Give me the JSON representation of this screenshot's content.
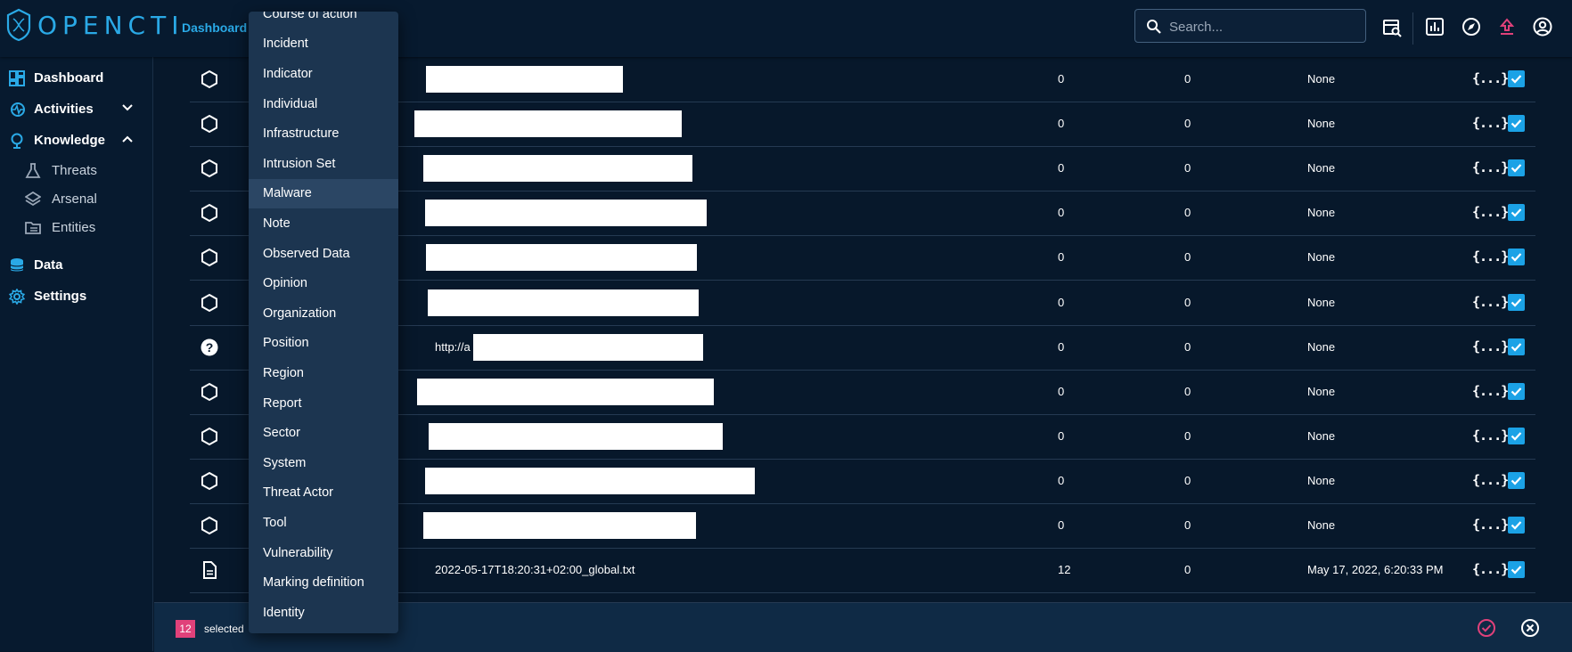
{
  "topbar": {
    "logo_text": "OPENCTI",
    "dashboard_label": "Dashboard",
    "search_placeholder": "Search..."
  },
  "sidebar": {
    "items": [
      {
        "label": "Dashboard",
        "icon": "dashboard-icon"
      },
      {
        "label": "Activities",
        "icon": "activities-icon"
      },
      {
        "label": "Knowledge",
        "icon": "knowledge-icon"
      },
      {
        "label": "Threats",
        "icon": "flask-icon"
      },
      {
        "label": "Arsenal",
        "icon": "layers-icon"
      },
      {
        "label": "Entities",
        "icon": "folder-icon"
      },
      {
        "label": "Data",
        "icon": "database-icon"
      },
      {
        "label": "Settings",
        "icon": "gear-icon"
      }
    ]
  },
  "dropdown": {
    "items": [
      "Course of action",
      "Incident",
      "Indicator",
      "Individual",
      "Infrastructure",
      "Intrusion Set",
      "Malware",
      "Note",
      "Observed Data",
      "Opinion",
      "Organization",
      "Position",
      "Region",
      "Report",
      "Sector",
      "System",
      "Threat Actor",
      "Tool",
      "Vulnerability",
      "Marking definition",
      "Identity"
    ],
    "highlighted": "Malware"
  },
  "table": {
    "rows": [
      {
        "icon": "hexagon-icon",
        "text": "",
        "objects": "0",
        "refs": "0",
        "date": "None"
      },
      {
        "icon": "hexagon-icon",
        "text": "",
        "objects": "0",
        "refs": "0",
        "date": "None"
      },
      {
        "icon": "hexagon-icon",
        "text": "",
        "objects": "0",
        "refs": "0",
        "date": "None"
      },
      {
        "icon": "hexagon-icon",
        "text": "",
        "objects": "0",
        "refs": "0",
        "date": "None"
      },
      {
        "icon": "hexagon-icon",
        "text": "",
        "objects": "0",
        "refs": "0",
        "date": "None"
      },
      {
        "icon": "hexagon-icon",
        "text": "",
        "objects": "0",
        "refs": "0",
        "date": "None"
      },
      {
        "icon": "question-icon",
        "text": "http://a",
        "objects": "0",
        "refs": "0",
        "date": "None"
      },
      {
        "icon": "hexagon-icon",
        "text": "",
        "objects": "0",
        "refs": "0",
        "date": "None"
      },
      {
        "icon": "hexagon-icon",
        "text": "",
        "objects": "0",
        "refs": "0",
        "date": "None"
      },
      {
        "icon": "hexagon-icon",
        "text": "",
        "objects": "0",
        "refs": "0",
        "date": "None"
      },
      {
        "icon": "hexagon-icon",
        "text": "",
        "objects": "0",
        "refs": "0",
        "date": "None"
      },
      {
        "icon": "file-icon",
        "text": "2022-05-17T18:20:31+02:00_global.txt",
        "objects": "12",
        "refs": "0",
        "date": "May 17, 2022, 6:20:33 PM"
      }
    ],
    "json_label": "{...}"
  },
  "bottombar": {
    "count": "12",
    "selected_label": "selected"
  },
  "colors": {
    "accent": "#1ba2e6",
    "brand": "#2aa9e6",
    "pink": "#e0417a"
  }
}
